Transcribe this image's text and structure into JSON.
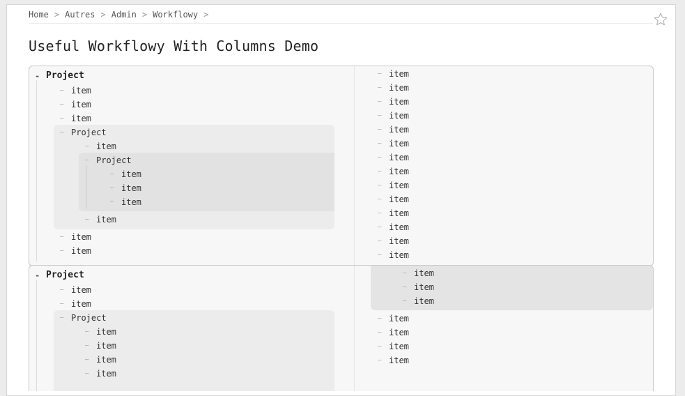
{
  "breadcrumb": {
    "items": [
      "Home",
      "Autres",
      "Admin",
      "Workflowy"
    ],
    "separator": ">"
  },
  "page": {
    "title": "Useful Workflowy With Columns Demo"
  },
  "icons": {
    "star": "star-outline-icon",
    "bullet": "dash-bullet-icon"
  },
  "outline": {
    "block1": {
      "root": "Project",
      "left": [
        "item",
        "item",
        "item",
        "Project",
        "item",
        "Project",
        "item",
        "item",
        "item",
        "item",
        "item",
        "item"
      ],
      "right": [
        "item",
        "item",
        "item",
        "item",
        "item",
        "item",
        "item",
        "item",
        "item",
        "item",
        "item",
        "item",
        "item",
        "item"
      ]
    },
    "block2": {
      "root": "Project",
      "left": [
        "item",
        "item",
        "Project",
        "item",
        "item",
        "item",
        "item"
      ],
      "right": [
        "item",
        "item",
        "item",
        "item",
        "item",
        "item",
        "item"
      ]
    }
  },
  "colors": {
    "page_bg": "#ffffff",
    "block_bg": "#f7f7f7",
    "nested_bg": "#ececec",
    "nested_bg_2": "#e2e2e2"
  }
}
